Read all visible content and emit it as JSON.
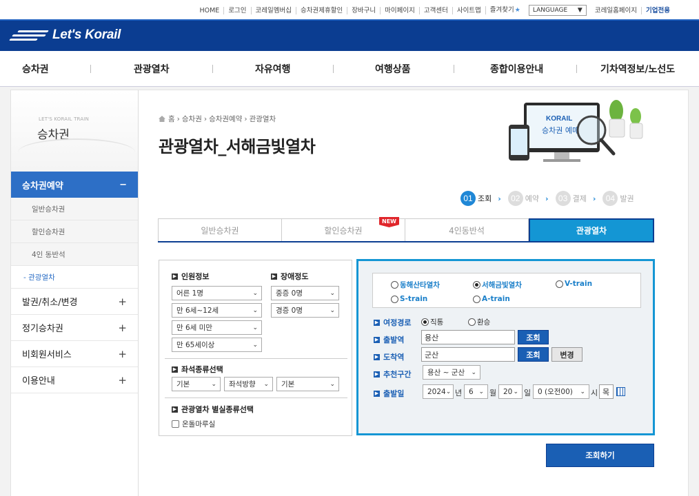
{
  "util": {
    "items": [
      "HOME",
      "로그인",
      "코레일멤버십",
      "승차권제휴할인",
      "장바구니",
      "마이페이지",
      "고객센터",
      "사이트맵",
      "즐겨찾기"
    ],
    "language": "LANGUAGE",
    "homepage": "코레일홈페이지",
    "corp": "기업전용"
  },
  "header": {
    "logo": "Let's Korail"
  },
  "gnb": [
    "승차권",
    "관광열차",
    "자유여행",
    "여행상품",
    "종합이용안내",
    "기차역정보/노선도"
  ],
  "lnb": {
    "sub": "LET'S KORAIL TRAIN",
    "title": "승차권",
    "active": "승차권예약",
    "active_sign": "−",
    "subitems": [
      "일반승차권",
      "할인승차권",
      "4인 동반석",
      "- 관광열차"
    ],
    "items": [
      "발권/취소/변경",
      "정기승차권",
      "비회원서비스",
      "이용안내"
    ],
    "plus": "+"
  },
  "breadcrumb": [
    "홈",
    "승차권",
    "승차권예약",
    "관광열차"
  ],
  "page_title": "관광열차_서해금빛열차",
  "hero": {
    "brand": "KORAIL",
    "text": "승차권 예매"
  },
  "steps": [
    {
      "num": "01",
      "label": "조회"
    },
    {
      "num": "02",
      "label": "예약"
    },
    {
      "num": "03",
      "label": "결제"
    },
    {
      "num": "04",
      "label": "발권"
    }
  ],
  "tabs": [
    "일반승차권",
    "할인승차권",
    "4인동반석",
    "관광열차"
  ],
  "new_badge": "NEW",
  "form_left": {
    "persons_title": "인원정보",
    "disability_title": "장애정도",
    "persons": [
      "어른 1명",
      "만 6세~12세",
      "만 6세 미만",
      "만 65세이상"
    ],
    "disability": [
      "중증 0명",
      "경증 0명"
    ],
    "seat_title": "좌석종류선택",
    "seat": [
      "기본",
      "좌석방향",
      "기본"
    ],
    "room_title": "관광열차 별실종류선택",
    "room_option": "온돌마루실"
  },
  "form_right": {
    "trains": [
      "동해산타열차",
      "서해금빛열차",
      "V-train",
      "S-train",
      "A-train"
    ],
    "route_label": "여정경로",
    "route_options": [
      "직통",
      "환승"
    ],
    "dep_label": "출발역",
    "dep_value": "용산",
    "arr_label": "도착역",
    "arr_value": "군산",
    "lookup": "조회",
    "change": "변경",
    "rec_label": "추천구간",
    "rec_value": "용산 ~ 군산",
    "date_label": "출발일",
    "year": "2024",
    "year_unit": "년",
    "month": "6",
    "month_unit": "월",
    "day": "20",
    "day_unit": "일",
    "hour": "0 (오전00)",
    "hour_unit": "시",
    "weekday": "목"
  },
  "search_button": "조회하기"
}
